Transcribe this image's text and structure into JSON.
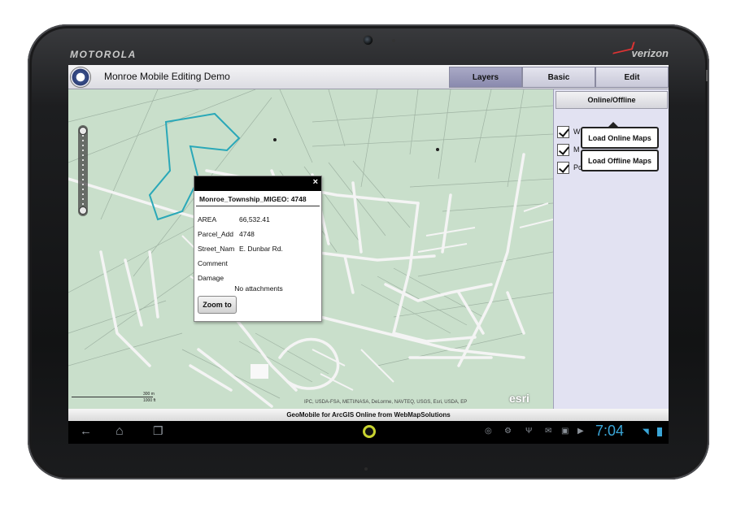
{
  "device": {
    "brand": "MOTOROLA",
    "carrier": "verizon"
  },
  "app": {
    "title": "Monroe Mobile Editing Demo",
    "tabs": [
      {
        "label": "Layers",
        "active": true
      },
      {
        "label": "Basic",
        "active": false
      },
      {
        "label": "Edit",
        "active": false
      }
    ]
  },
  "panel": {
    "button": "Online/Offline",
    "layers": [
      {
        "label": "W",
        "checked": true
      },
      {
        "label": "M",
        "checked": true
      },
      {
        "label": "Pc",
        "checked": true
      }
    ]
  },
  "menu": {
    "items": [
      "Load Online Maps",
      "Load Offline Maps"
    ]
  },
  "popup": {
    "title": "Monroe_Township_MIGEO: 4748",
    "close": "×",
    "attributes": [
      {
        "key": "AREA",
        "value": "66,532.41"
      },
      {
        "key": "Parcel_Add",
        "value": "4748"
      },
      {
        "key": "Street_Nam",
        "value": "E. Dunbar Rd."
      },
      {
        "key": "Comment",
        "value": ""
      },
      {
        "key": "Damage",
        "value": ""
      }
    ],
    "attachments": "No attachments",
    "zoom_button": "Zoom to"
  },
  "map": {
    "scale_m": "300 m",
    "scale_ft": "1000 ft",
    "attribution": "IPC, USDA-FSA, METI/NASA, DeLorme, NAVTEQ, USGS, Esri, USDA, EP",
    "logo": "esri",
    "colors": {
      "land": "#c9dfcb",
      "road": "#f4f4f4",
      "parcel_line": "#9fb3a3",
      "selection": "#2aa8b8"
    }
  },
  "footer": {
    "text": "GeoMobile for ArcGIS Online from WebMapSolutions"
  },
  "statusbar": {
    "time": "7:04",
    "accent": "#3aa6d8"
  },
  "icons": [
    "back-icon",
    "home-icon",
    "recent-apps-icon",
    "gps-icon",
    "android-icon",
    "usb-icon",
    "mail-icon",
    "shop-icon",
    "play-icon",
    "wifi-icon",
    "battery-icon"
  ]
}
